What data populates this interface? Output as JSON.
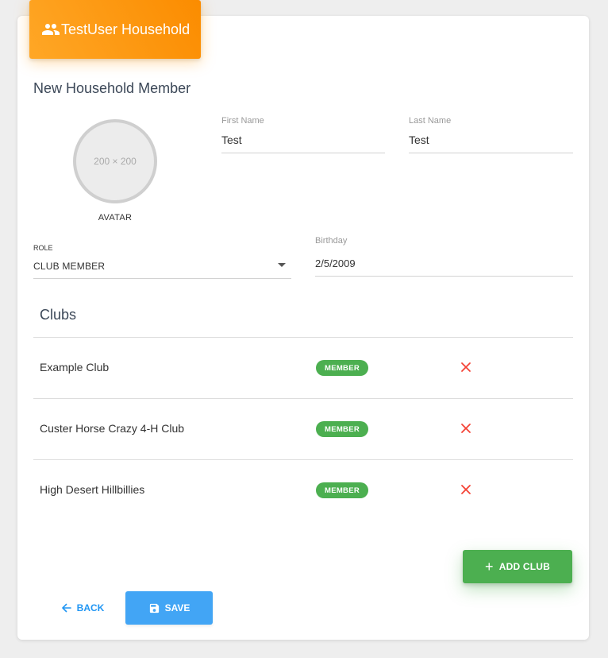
{
  "header": {
    "title": "TestUser Household",
    "icon": "people-icon",
    "color": "#fb8c00"
  },
  "form": {
    "title": "New Household Member",
    "avatar": {
      "placeholder": "200 × 200",
      "label": "AVATAR"
    },
    "first_name": {
      "label": "First Name",
      "value": "Test"
    },
    "last_name": {
      "label": "Last Name",
      "value": "Test"
    },
    "role": {
      "label": "ROLE",
      "value": "CLUB MEMBER"
    },
    "birthday": {
      "label": "Birthday",
      "value": "2/5/2009"
    }
  },
  "clubs": {
    "title": "Clubs",
    "items": [
      {
        "name": "Example Club",
        "badge": "MEMBER"
      },
      {
        "name": "Custer Horse Crazy 4-H Club",
        "badge": "MEMBER"
      },
      {
        "name": "High Desert Hillbillies",
        "badge": "MEMBER"
      }
    ],
    "badge_color": "#4caf50",
    "remove_icon_color": "#f44336"
  },
  "actions": {
    "add_club": "ADD CLUB",
    "back": "BACK",
    "save": "SAVE",
    "save_color": "#42a5f5"
  }
}
